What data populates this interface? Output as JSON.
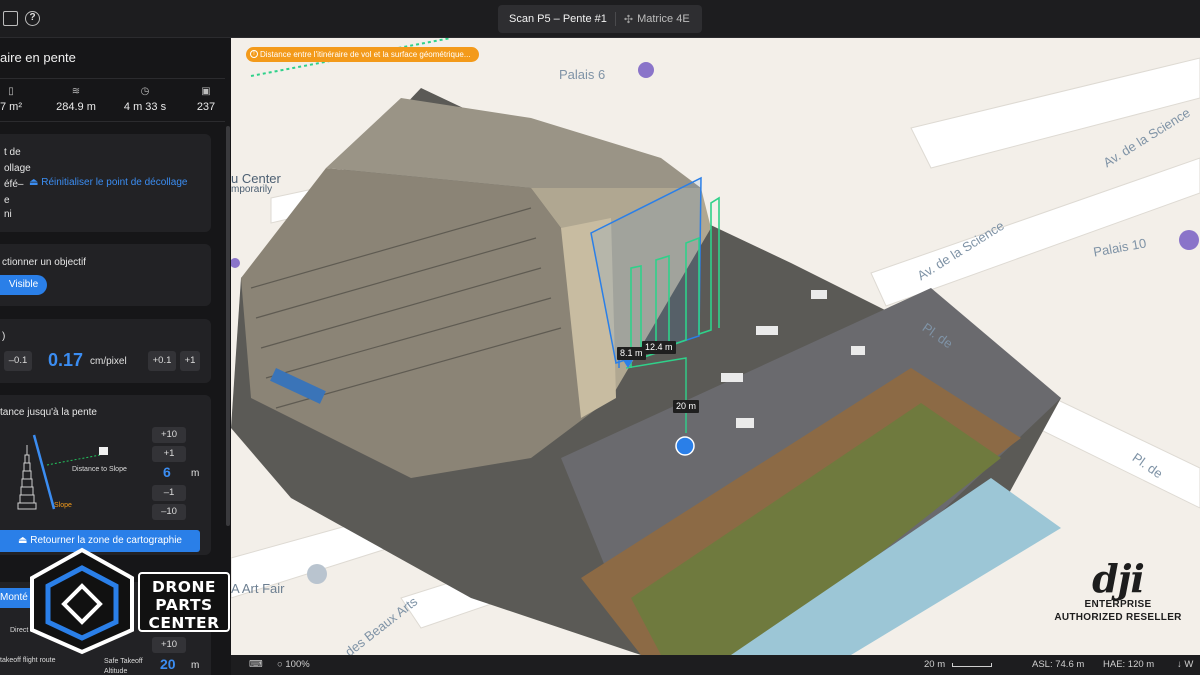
{
  "topbar": {
    "title": "Scan P5 – Pente #1",
    "camera": "Matrice 4E",
    "camera_icon": "drone-icon",
    "help_icon": "help-icon",
    "folder_icon": "folder-icon"
  },
  "sidebar": {
    "title": "aire en pente",
    "stats": [
      {
        "icon": "area-icon",
        "value": "7 m²"
      },
      {
        "icon": "distance-icon",
        "value": "284.9 m"
      },
      {
        "icon": "clock-icon",
        "value": "4 m 33 s"
      },
      {
        "icon": "photos-icon",
        "value": "237"
      }
    ],
    "takeoff": {
      "lines": [
        "t de",
        "ollage",
        "éfé–",
        "e",
        "ni"
      ],
      "reset_link": "Réinitialiser le point de décollage"
    },
    "target": {
      "label": "ctionner un objectif",
      "button": "Visible"
    },
    "gsd": {
      "label": ")",
      "minus_label": "–0.1",
      "value": "0.17",
      "unit": "cm/pixel",
      "plus_small": "+0.1",
      "plus_big": "+1"
    },
    "slope_distance": {
      "label": "tance jusqu'à la pente",
      "plus10": "+10",
      "plus1": "+1",
      "value": "6",
      "unit": "m",
      "minus1": "–1",
      "minus10": "–10",
      "diagram_label": "Distance to Slope",
      "slope_label": "Slope"
    },
    "return_button": "Retourner la zone de cartographie",
    "ascent": {
      "button": "Monté",
      "direct_label": "Direct ascent",
      "takeoff_route": "takeoff flight route",
      "safe_takeoff": "Safe Takeoff",
      "altitude": "Altitude",
      "plus10": "+10",
      "value": "20",
      "unit": "m"
    }
  },
  "logo": {
    "line1": "DRONE",
    "line2": "PARTS",
    "line3": "CENTER"
  },
  "map": {
    "warning": "Distance entre l'itinéraire de vol et la surface géométrique...",
    "labels": {
      "palais6": "Palais 6",
      "palais10": "Palais 10",
      "av_science_1": "Av. de la Science",
      "av_science_2": "Av. de la Science",
      "pl_de_1": "Pl. de",
      "pl_de_2": "Pl. de",
      "u_center": "u Center",
      "temporarily": "mporarily",
      "art_fair": "A Art Fair",
      "beaux_arts": "v. des Beaux Arts"
    },
    "tags": {
      "d1": "8.1 m",
      "d2": "12.4 m",
      "d3": "20 m"
    }
  },
  "bottombar": {
    "zoom": "100%",
    "scale": "20 m",
    "asl": "ASL: 74.6 m",
    "hae": "HAE: 120 m",
    "extra": "W"
  },
  "dji": {
    "word": "dji",
    "line1": "ENTERPRISE",
    "line2": "AUTHORIZED RESELLER"
  }
}
